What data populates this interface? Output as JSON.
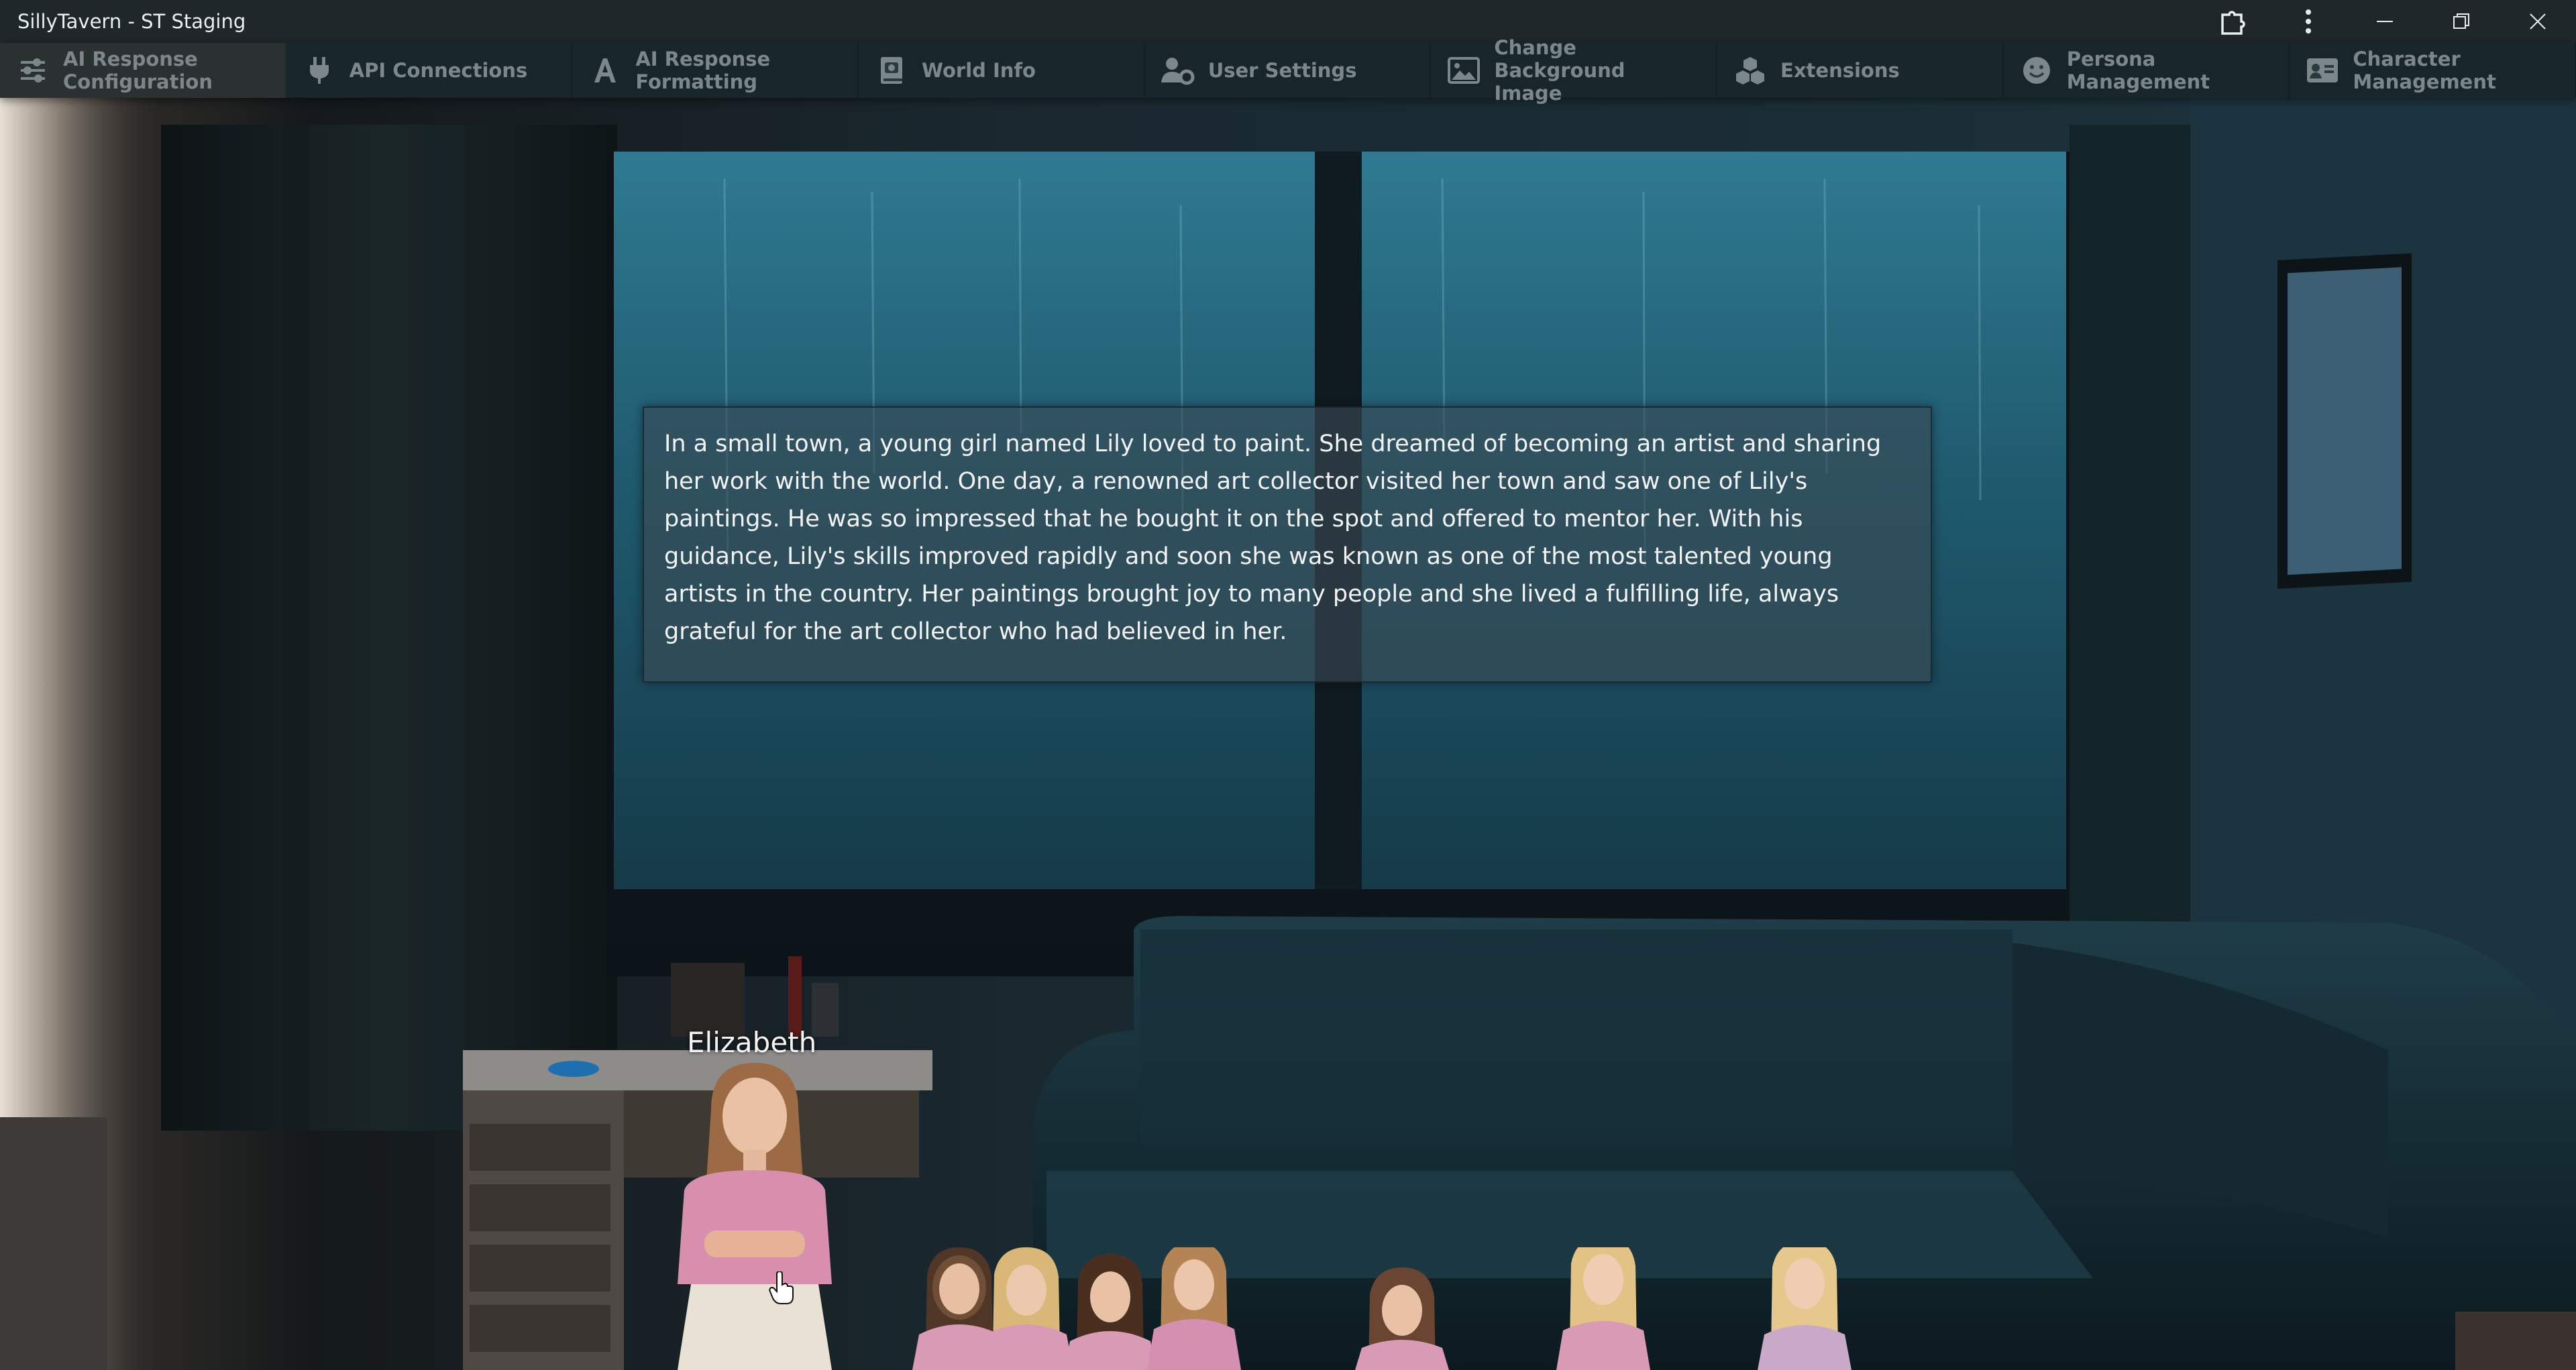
{
  "window": {
    "title": "SillyTavern - ST Staging",
    "controls": [
      "extensions-icon",
      "more-menu-icon",
      "minimize-icon",
      "restore-icon",
      "close-icon"
    ]
  },
  "topnav": {
    "items": [
      {
        "label": "AI Response Configuration",
        "icon": "sliders-icon"
      },
      {
        "label": "API Connections",
        "icon": "plug-icon"
      },
      {
        "label": "AI Response Formatting",
        "icon": "font-icon"
      },
      {
        "label": "World Info",
        "icon": "book-icon"
      },
      {
        "label": "User Settings",
        "icon": "user-gear-icon"
      },
      {
        "label": "Change Background Image",
        "icon": "image-icon"
      },
      {
        "label": "Extensions",
        "icon": "cubes-icon"
      },
      {
        "label": "Persona Management",
        "icon": "face-smile-icon"
      },
      {
        "label": "Character Management",
        "icon": "address-card-icon"
      }
    ]
  },
  "message": {
    "text": "In a small town, a young girl named Lily loved to paint. She dreamed of becoming an artist and sharing her work with the world. One day, a renowned art collector visited her town and saw one of Lily's paintings. He was so impressed that he bought it on the spot and offered to mentor her. With his guidance, Lily's skills improved rapidly and soon she was known as one of the most talented young artists in the country. Her paintings brought joy to many people and she lived a fulfilling life, always grateful for the art collector who had believed in her."
  },
  "characters": {
    "active_name": "Elizabeth",
    "sprite_count": 8
  },
  "colors": {
    "titlebar": "#20272b",
    "nav_text": "#7c878c",
    "message_bg": "#3a4a54",
    "scene_window": "#1f5a6e"
  }
}
